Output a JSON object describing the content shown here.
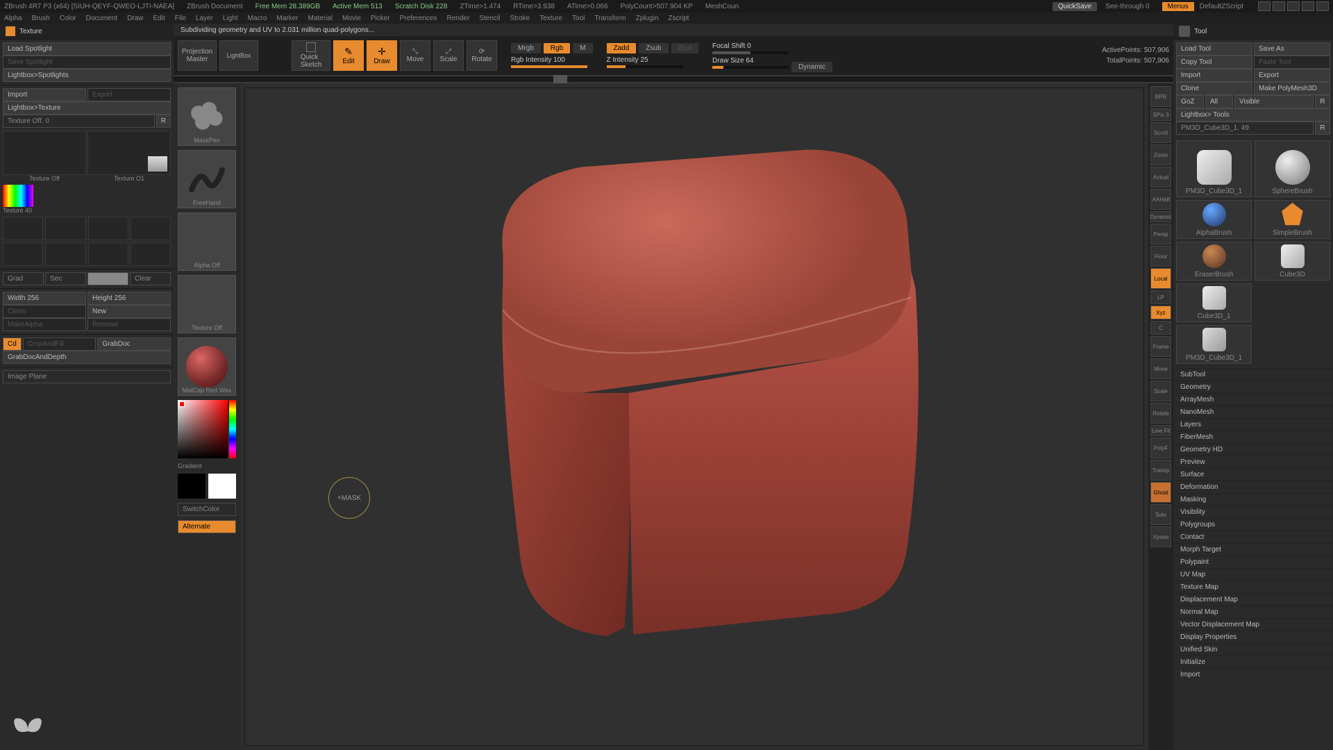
{
  "title": {
    "app": "ZBrush 4R7 P3 (x64) [SIUH-QEYF-QWEO-LJTI-NAEA]",
    "doc": "ZBrush Document",
    "freemem": "Free Mem 28.389GB",
    "activemem": "Active Mem 513",
    "scratch": "Scratch Disk 228",
    "ztime": "ZTime>1.474",
    "rtime": "RTime>3.938",
    "atime": "ATime>0.066",
    "polycount": "PolyCount>507.904 KP",
    "meshcount": "MeshCoun",
    "quicksave": "QuickSave",
    "seethrough": "See-through 0",
    "menus": "Menus",
    "script": "DefaultZScript"
  },
  "menu": [
    "Alpha",
    "Brush",
    "Color",
    "Document",
    "Draw",
    "Edit",
    "File",
    "Layer",
    "Light",
    "Macro",
    "Marker",
    "Material",
    "Movie",
    "Picker",
    "Preferences",
    "Render",
    "Stencil",
    "Stroke",
    "Texture",
    "Tool",
    "Transform",
    "Zplugin",
    "Zscript"
  ],
  "status": "Subdividing geometry and UV to 2.031 million quad-polygons...",
  "toolbar": {
    "projection": "Projection\nMaster",
    "lightbox": "LightBox",
    "quicksketch": "Quick\nSketch",
    "edit": "Edit",
    "draw": "Draw",
    "move": "Move",
    "scale": "Scale",
    "rotate": "Rotate",
    "mrgb": "Mrgb",
    "rgb": "Rgb",
    "m": "M",
    "rgbintensity": "Rgb Intensity 100",
    "zadd": "Zadd",
    "zsub": "Zsub",
    "zcut": "Zcut",
    "zintensity": "Z Intensity 25",
    "focalshift": "Focal Shift 0",
    "drawsize": "Draw Size 64",
    "dynamic": "Dynamic",
    "activepts": "ActivePoints: 507,906",
    "totalpts": "TotalPoints: 507,906"
  },
  "left": {
    "header": "Texture",
    "loadspot": "Load Spotlight",
    "savespot": "Save Spotlight",
    "lightspot": "Lightbox>Spotlights",
    "import": "Import",
    "export": "Export",
    "lighttex": "Lightbox>Texture",
    "texoff": "Texture Off. 0",
    "r": "R",
    "texoff2": "Texture Off",
    "texon": "Texture O1",
    "tex40": "Texture 40",
    "grad": "Grad",
    "sec": "Sec",
    "clear": "Clear",
    "width": "Width 256",
    "height": "Height 256",
    "clone": "Clone",
    "new": "New",
    "makealpha": "MakeAlpha",
    "remove": "Remove",
    "cd": "Cd",
    "cropfill": "CropAndFill",
    "grabdoc": "GrabDoc",
    "grabdocdepth": "GrabDocAndDepth",
    "imgplane": "Image Plane"
  },
  "thumbs": {
    "brush": "MaskPen",
    "stroke": "FreeHand",
    "alpha": "Alpha Off",
    "tex": "Texture Off",
    "mat": "MatCap Red Wax",
    "gradient": "Gradient",
    "switchcolor": "SwitchColor",
    "alternate": "Alternate"
  },
  "cursor": "+MASK",
  "sidetools": [
    "BPR",
    "SPix 3",
    "Scroll",
    "Zoom",
    "Actual",
    "AAHalf",
    "Dynamic",
    "Persp",
    "Floor",
    "Local",
    "Xyz",
    "LP",
    "C",
    "Frame",
    "Move",
    "Scale",
    "Rotate",
    "Line Fil",
    "PolyF",
    "Transp",
    "Ghost",
    "Solo",
    "Xpose"
  ],
  "right": {
    "header": "Tool",
    "loadtool": "Load Tool",
    "saveas": "Save As",
    "copytool": "Copy Tool",
    "pastetool": "Paste Tool",
    "import": "Import",
    "export": "Export",
    "clone": "Clone",
    "makepoly": "Make PolyMesh3D",
    "goz": "GoZ",
    "all": "All",
    "visible": "Visible",
    "r": "R",
    "lighttools": "Lightbox> Tools",
    "current": "PM3D_Cube3D_1. 49",
    "tools": [
      {
        "name": "PM3D_Cube3D_1"
      },
      {
        "name": "SphereBrush"
      },
      {
        "name": "AlphaBrush"
      },
      {
        "name": "SimpleBrush"
      },
      {
        "name": "EraserBrush"
      },
      {
        "name": "Cube3D"
      },
      {
        "name": "Cube3D_1"
      },
      {
        "name": "PM3D_Cube3D_1"
      }
    ],
    "sections": [
      "SubTool",
      "Geometry",
      "ArrayMesh",
      "NanoMesh",
      "Layers",
      "FiberMesh",
      "Geometry HD",
      "Preview",
      "Surface",
      "Deformation",
      "Masking",
      "Visibility",
      "Polygroups",
      "Contact",
      "Morph Target",
      "Polypaint",
      "UV Map",
      "Texture Map",
      "Displacement Map",
      "Normal Map",
      "Vector Displacement Map",
      "Display Properties",
      "Unified Skin",
      "Initialize",
      "Import"
    ]
  }
}
